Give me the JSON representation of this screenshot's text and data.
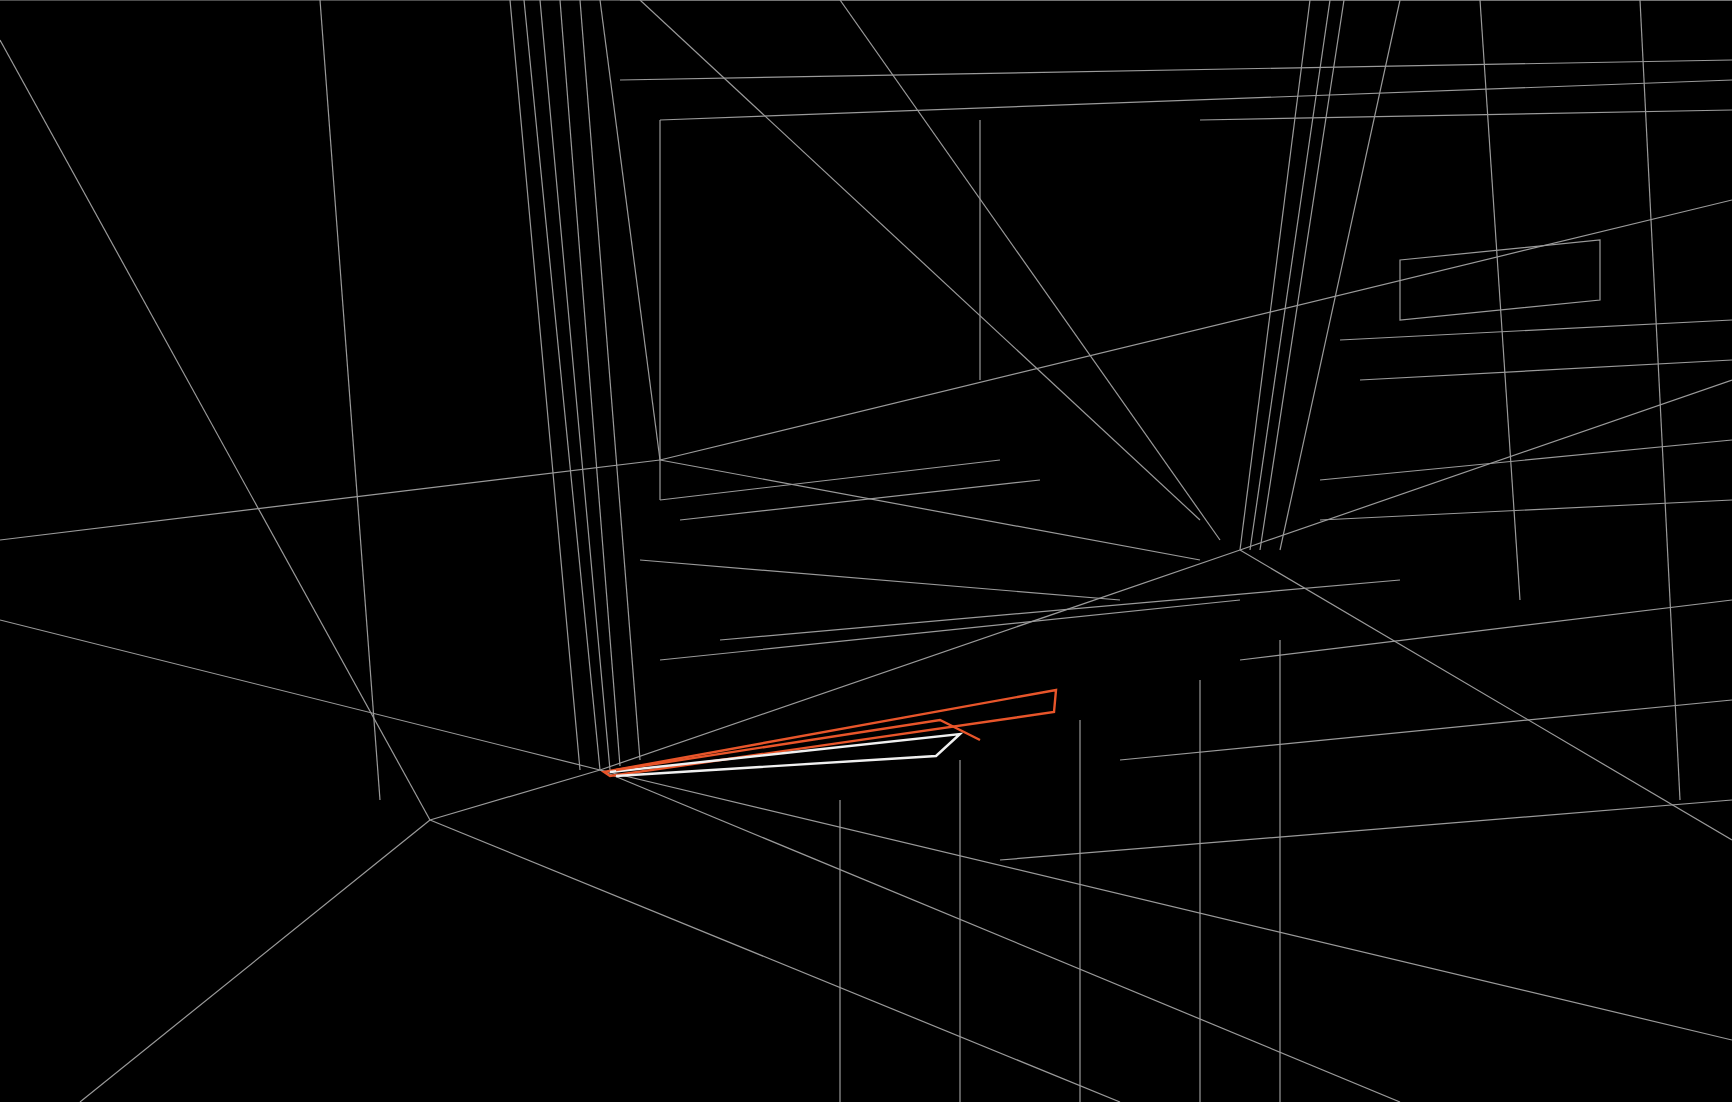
{
  "viewport": {
    "kind": "wireframe",
    "selection": {
      "kind": "brush"
    }
  }
}
